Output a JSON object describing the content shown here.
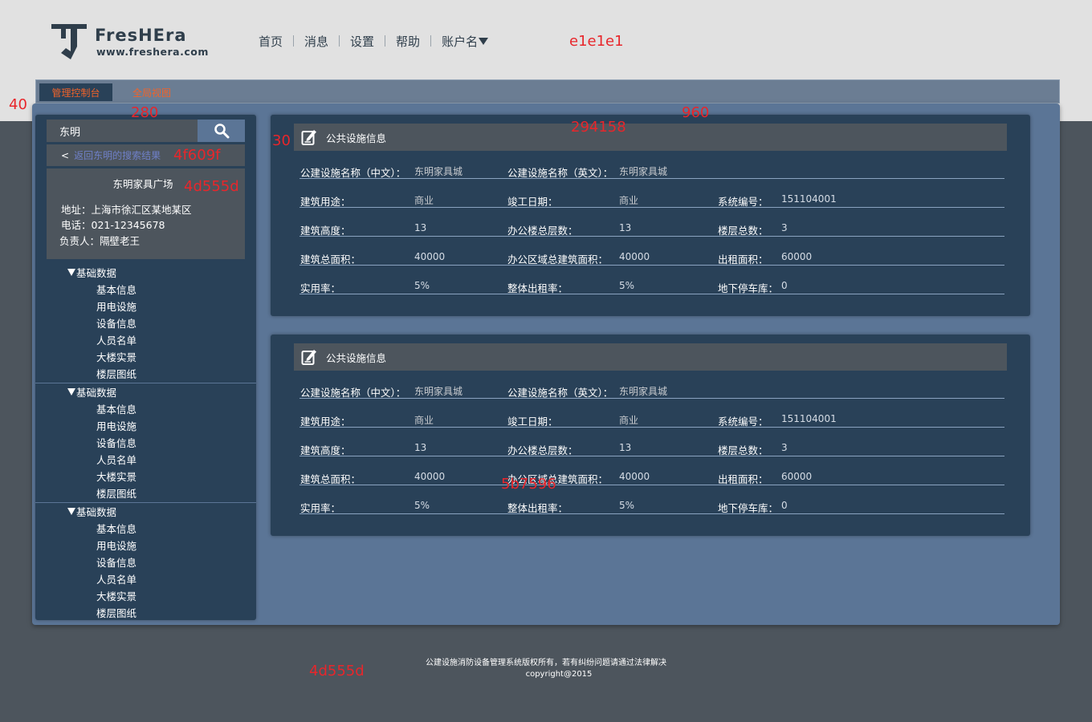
{
  "annotations": {
    "header_color": "e1e1e1",
    "tabbar_height": "40",
    "sidebar_width": "280",
    "content_width": "960",
    "card_color": "294158",
    "card_indent": "30",
    "back_link_color": "4f609f",
    "info_color": "4d555d",
    "row_color": "5b7596",
    "footer_color": "4d555d"
  },
  "brand": {
    "name": "FresHEra",
    "url": "www.freshera.com"
  },
  "nav": {
    "items": [
      "首页",
      "消息",
      "设置",
      "帮助"
    ],
    "account": "账户名"
  },
  "tabs": {
    "active": "管理控制台",
    "second": "全局视图"
  },
  "search": {
    "value": "东明"
  },
  "back_link": {
    "arrow": "<",
    "text": "返回东明的搜索结果"
  },
  "info": {
    "title": "东明家具广场",
    "address": "地址：上海市徐汇区某地某区",
    "phone": "电话：021-12345678",
    "manager": "负责人：隔壁老王"
  },
  "tree": [
    {
      "head": "基础数据",
      "items": [
        "基本信息",
        "用电设施",
        "设备信息",
        "人员名单",
        "大楼实景",
        "楼层图纸"
      ]
    },
    {
      "head": "基础数据",
      "items": [
        "基本信息",
        "用电设施",
        "设备信息",
        "人员名单",
        "大楼实景",
        "楼层图纸"
      ]
    },
    {
      "head": "基础数据",
      "items": [
        "基本信息",
        "用电设施",
        "设备信息",
        "人员名单",
        "大楼实景",
        "楼层图纸"
      ]
    }
  ],
  "cards": [
    {
      "title": "公共设施信息",
      "fields": {
        "name_cn_label": "公建设施名称（中文）：",
        "name_cn": "东明家具城",
        "name_en_label": "公建设施名称（英文）：",
        "name_en": "东明家具城",
        "usage_label": "建筑用途：",
        "usage": "商业",
        "completion_label": "竣工日期：",
        "completion": "商业",
        "sysno_label": "系统编号：",
        "sysno": "151104001",
        "height_label": "建筑高度：",
        "height": "13",
        "office_floors_label": "办公楼总层数：",
        "office_floors": "13",
        "floors_label": "楼层总数：",
        "floors": "3",
        "total_area_label": "建筑总面积：",
        "total_area": "40000",
        "office_area_label": "办公区域总建筑面积：",
        "office_area": "40000",
        "rent_area_label": "出租面积：",
        "rent_area": "60000",
        "usage_rate_label": "实用率：",
        "usage_rate": "5%",
        "rent_rate_label": "整体出租率：",
        "rent_rate": "5%",
        "parking_label": "地下停车库：",
        "parking": "0"
      }
    },
    {
      "title": "公共设施信息",
      "fields": {
        "name_cn_label": "公建设施名称（中文）：",
        "name_cn": "东明家具城",
        "name_en_label": "公建设施名称（英文）：",
        "name_en": "东明家具城",
        "usage_label": "建筑用途：",
        "usage": "商业",
        "completion_label": "竣工日期：",
        "completion": "商业",
        "sysno_label": "系统编号：",
        "sysno": "151104001",
        "height_label": "建筑高度：",
        "height": "13",
        "office_floors_label": "办公楼总层数：",
        "office_floors": "13",
        "floors_label": "楼层总数：",
        "floors": "3",
        "total_area_label": "建筑总面积：",
        "total_area": "40000",
        "office_area_label": "办公区域总建筑面积：",
        "office_area": "40000",
        "rent_area_label": "出租面积：",
        "rent_area": "60000",
        "usage_rate_label": "实用率：",
        "usage_rate": "5%",
        "rent_rate_label": "整体出租率：",
        "rent_rate": "5%",
        "parking_label": "地下停车库：",
        "parking": "0"
      }
    }
  ],
  "footer": {
    "line1": "公建设施消防设备管理系统版权所有，若有纠纷问题请通过法律解决",
    "line2": "copyright@2015"
  },
  "colors": {
    "header_bg": "#e1e1e1",
    "page_bg": "#4d555d",
    "content_bg": "#5b7596",
    "card_bg": "#294158",
    "accent": "#f0632a",
    "link": "#4f609f"
  }
}
